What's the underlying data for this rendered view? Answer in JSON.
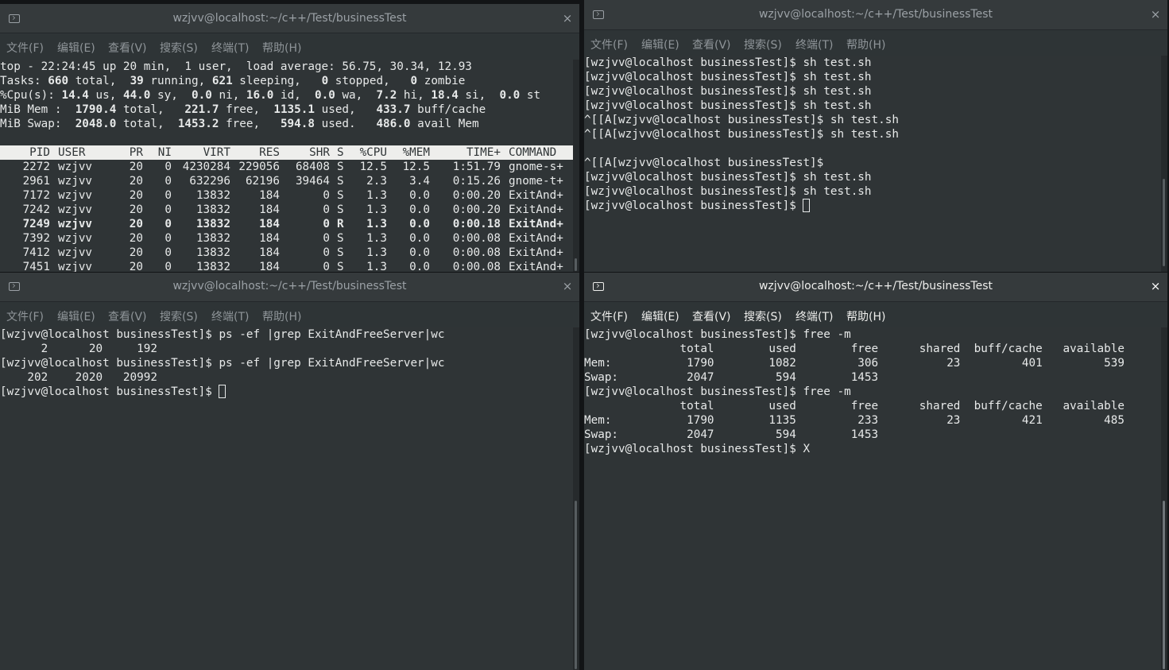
{
  "menu": [
    "文件(F)",
    "编辑(E)",
    "查看(V)",
    "搜索(S)",
    "终端(T)",
    "帮助(H)"
  ],
  "close_glyph": "×",
  "windows": {
    "top_left": {
      "title": "wzjvv@localhost:~/c++/Test/businessTest",
      "summary": [
        [
          {
            "t": "top - 22:24:45 up 20 min,  1 user,  load average: 56.75, 30.34, 12.93"
          }
        ],
        [
          {
            "t": "Tasks: "
          },
          {
            "t": "660",
            "b": true
          },
          {
            "t": " total,  "
          },
          {
            "t": "39",
            "b": true
          },
          {
            "t": " running, "
          },
          {
            "t": "621",
            "b": true
          },
          {
            "t": " sleeping,   "
          },
          {
            "t": "0",
            "b": true
          },
          {
            "t": " stopped,   "
          },
          {
            "t": "0",
            "b": true
          },
          {
            "t": " zombie"
          }
        ],
        [
          {
            "t": "%Cpu(s): "
          },
          {
            "t": "14.4",
            "b": true
          },
          {
            "t": " us, "
          },
          {
            "t": "44.0",
            "b": true
          },
          {
            "t": " sy,  "
          },
          {
            "t": "0.0",
            "b": true
          },
          {
            "t": " ni, "
          },
          {
            "t": "16.0",
            "b": true
          },
          {
            "t": " id,  "
          },
          {
            "t": "0.0",
            "b": true
          },
          {
            "t": " wa,  "
          },
          {
            "t": "7.2",
            "b": true
          },
          {
            "t": " hi, "
          },
          {
            "t": "18.4",
            "b": true
          },
          {
            "t": " si,  "
          },
          {
            "t": "0.0",
            "b": true
          },
          {
            "t": " st"
          }
        ],
        [
          {
            "t": "MiB Mem :  "
          },
          {
            "t": "1790.4",
            "b": true
          },
          {
            "t": " total,   "
          },
          {
            "t": "221.7",
            "b": true
          },
          {
            "t": " free,  "
          },
          {
            "t": "1135.1",
            "b": true
          },
          {
            "t": " used,   "
          },
          {
            "t": "433.7",
            "b": true
          },
          {
            "t": " buff/cache"
          }
        ],
        [
          {
            "t": "MiB Swap:  "
          },
          {
            "t": "2048.0",
            "b": true
          },
          {
            "t": " total,  "
          },
          {
            "t": "1453.2",
            "b": true
          },
          {
            "t": " free,   "
          },
          {
            "t": "594.8",
            "b": true
          },
          {
            "t": " used.   "
          },
          {
            "t": "486.0",
            "b": true
          },
          {
            "t": " avail Mem"
          }
        ]
      ],
      "columns": [
        "PID",
        "USER",
        "PR",
        "NI",
        "VIRT",
        "RES",
        "SHR",
        "S",
        "%CPU",
        "%MEM",
        "TIME+",
        "COMMAND"
      ],
      "processes": [
        {
          "pid": "2272",
          "user": "wzjvv",
          "pr": "20",
          "ni": "0",
          "virt": "4230284",
          "res": "229056",
          "shr": "68408",
          "s": "S",
          "cpu": "12.5",
          "mem": "12.5",
          "time": "1:51.79",
          "cmd": "gnome-s+",
          "bold": false
        },
        {
          "pid": "2961",
          "user": "wzjvv",
          "pr": "20",
          "ni": "0",
          "virt": "632296",
          "res": "62196",
          "shr": "39464",
          "s": "S",
          "cpu": "2.3",
          "mem": "3.4",
          "time": "0:15.26",
          "cmd": "gnome-t+",
          "bold": false
        },
        {
          "pid": "7172",
          "user": "wzjvv",
          "pr": "20",
          "ni": "0",
          "virt": "13832",
          "res": "184",
          "shr": "0",
          "s": "S",
          "cpu": "1.3",
          "mem": "0.0",
          "time": "0:00.20",
          "cmd": "ExitAnd+",
          "bold": false
        },
        {
          "pid": "7242",
          "user": "wzjvv",
          "pr": "20",
          "ni": "0",
          "virt": "13832",
          "res": "184",
          "shr": "0",
          "s": "S",
          "cpu": "1.3",
          "mem": "0.0",
          "time": "0:00.20",
          "cmd": "ExitAnd+",
          "bold": false
        },
        {
          "pid": "7249",
          "user": "wzjvv",
          "pr": "20",
          "ni": "0",
          "virt": "13832",
          "res": "184",
          "shr": "0",
          "s": "R",
          "cpu": "1.3",
          "mem": "0.0",
          "time": "0:00.18",
          "cmd": "ExitAnd+",
          "bold": true
        },
        {
          "pid": "7392",
          "user": "wzjvv",
          "pr": "20",
          "ni": "0",
          "virt": "13832",
          "res": "184",
          "shr": "0",
          "s": "S",
          "cpu": "1.3",
          "mem": "0.0",
          "time": "0:00.08",
          "cmd": "ExitAnd+",
          "bold": false
        },
        {
          "pid": "7412",
          "user": "wzjvv",
          "pr": "20",
          "ni": "0",
          "virt": "13832",
          "res": "184",
          "shr": "0",
          "s": "S",
          "cpu": "1.3",
          "mem": "0.0",
          "time": "0:00.08",
          "cmd": "ExitAnd+",
          "bold": false
        },
        {
          "pid": "7451",
          "user": "wzjvv",
          "pr": "20",
          "ni": "0",
          "virt": "13832",
          "res": "184",
          "shr": "0",
          "s": "S",
          "cpu": "1.3",
          "mem": "0.0",
          "time": "0:00.08",
          "cmd": "ExitAnd+",
          "bold": false
        }
      ]
    },
    "top_right": {
      "title": "wzjvv@localhost:~/c++/Test/businessTest",
      "lines": [
        "[wzjvv@localhost businessTest]$ sh test.sh",
        "[wzjvv@localhost businessTest]$ sh test.sh",
        "[wzjvv@localhost businessTest]$ sh test.sh",
        "[wzjvv@localhost businessTest]$ sh test.sh",
        "^[[A[wzjvv@localhost businessTest]$ sh test.sh",
        "^[[A[wzjvv@localhost businessTest]$ sh test.sh",
        "",
        "^[[A[wzjvv@localhost businessTest]$",
        "[wzjvv@localhost businessTest]$ sh test.sh",
        "[wzjvv@localhost businessTest]$ sh test.sh"
      ],
      "prompt": "[wzjvv@localhost businessTest]$ "
    },
    "bottom_left": {
      "title": "wzjvv@localhost:~/c++/Test/businessTest",
      "lines": [
        "[wzjvv@localhost businessTest]$ ps -ef |grep ExitAndFreeServer|wc",
        "      2      20     192",
        "[wzjvv@localhost businessTest]$ ps -ef |grep ExitAndFreeServer|wc",
        "    202    2020   20992"
      ],
      "prompt": "[wzjvv@localhost businessTest]$ "
    },
    "bottom_right": {
      "title": "wzjvv@localhost:~/c++/Test/businessTest",
      "lines": [
        "[wzjvv@localhost businessTest]$ free -m",
        "              total        used        free      shared  buff/cache   available",
        "Mem:           1790        1082         306          23         401         539",
        "Swap:          2047         594        1453",
        "[wzjvv@localhost businessTest]$ free -m",
        "              total        used        free      shared  buff/cache   available",
        "Mem:           1790        1135         233          23         421         485",
        "Swap:          2047         594        1453",
        "[wzjvv@localhost businessTest]$ X"
      ]
    }
  }
}
